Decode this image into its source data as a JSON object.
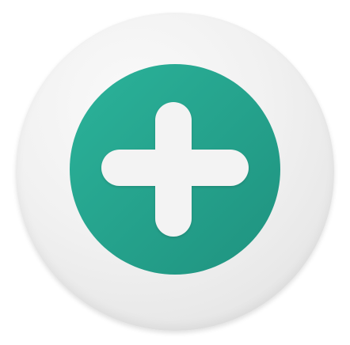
{
  "app_icon": {
    "name": "plus-app-icon",
    "icon": "plus-icon",
    "colors": {
      "outer_background": "#efefef",
      "circle": "#27a58f",
      "circle_dark": "#1f927f",
      "plus": "#f3f3f3"
    }
  }
}
